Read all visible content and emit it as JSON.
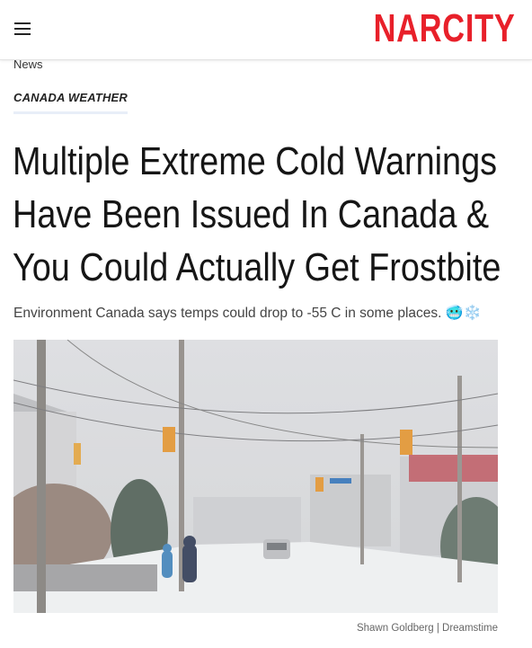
{
  "header": {
    "menu_icon": "hamburger-menu-icon",
    "logo": "NARCITY",
    "brand_color": "#e8202a"
  },
  "breadcrumb": "News",
  "category_tag": "CANADA WEATHER",
  "headline": "Multiple Extreme Cold Warnings Have Been Issued In Canada & You Could Actually Get Frostbite",
  "subhead": "Environment Canada says temps could drop to -55 C in some places.",
  "subhead_emojis": "🥶❄️",
  "photo": {
    "description_icon": "snowy-street-photo",
    "credit": "Shawn Goldberg | Dreamstime"
  }
}
